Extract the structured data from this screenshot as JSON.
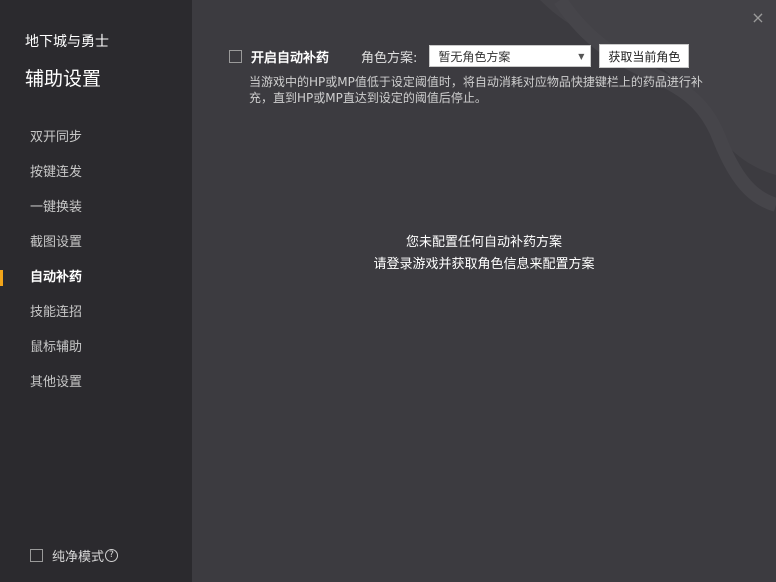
{
  "app": {
    "title": "地下城与勇士",
    "page_title": "辅助设置",
    "close_glyph": "×"
  },
  "sidebar": {
    "items": [
      {
        "label": "双开同步"
      },
      {
        "label": "按键连发"
      },
      {
        "label": "一键换装"
      },
      {
        "label": "截图设置"
      },
      {
        "label": "自动补药",
        "active": true
      },
      {
        "label": "技能连招"
      },
      {
        "label": "鼠标辅助"
      },
      {
        "label": "其他设置"
      }
    ],
    "pure_mode": {
      "label": "纯净模式",
      "checked": false,
      "help_glyph": "?"
    }
  },
  "main": {
    "enable_label": "开启自动补药",
    "enable_checked": false,
    "role_label": "角色方案:",
    "role_select_value": "暂无角色方案",
    "fetch_button": "获取当前角色",
    "description": "当游戏中的HP或MP值低于设定阈值时，将自动消耗对应物品快捷键栏上的药品进行补充，直到HP或MP直达到设定的阈值后停止。",
    "empty_line1": "您未配置任何自动补药方案",
    "empty_line2": "请登录游戏并获取角色信息来配置方案"
  },
  "colors": {
    "accent": "#f2a51a",
    "sidebar_bg": "#2b2a2e",
    "main_bg": "#3c3b40"
  }
}
